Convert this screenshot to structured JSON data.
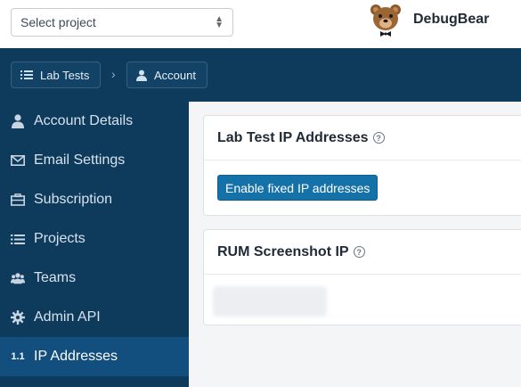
{
  "topbar": {
    "project_select": {
      "value": "Select project",
      "icon": "sort-caret-icon"
    },
    "brand": {
      "name": "DebugBear",
      "logo": "bear-logo"
    }
  },
  "breadcrumb": {
    "items": [
      {
        "label": "Lab Tests",
        "icon": "list-icon"
      },
      {
        "label": "Account",
        "icon": "user-icon"
      }
    ],
    "separator": "›"
  },
  "sidebar": {
    "items": [
      {
        "label": "Account Details",
        "icon": "user-icon"
      },
      {
        "label": "Email Settings",
        "icon": "envelope-icon"
      },
      {
        "label": "Subscription",
        "icon": "briefcase-icon"
      },
      {
        "label": "Projects",
        "icon": "list-icon"
      },
      {
        "label": "Teams",
        "icon": "users-icon"
      },
      {
        "label": "Admin API",
        "icon": "gear-icon"
      },
      {
        "label": "IP Addresses",
        "icon": "numbering-icon",
        "prefix": "1.1",
        "active": true
      }
    ]
  },
  "main": {
    "lab_card": {
      "title": "Lab Test IP Addresses",
      "button": "Enable fixed IP addresses"
    },
    "rum_card": {
      "title": "RUM Screenshot IP"
    },
    "help_glyph": "?"
  },
  "colors": {
    "nav_bg": "#0e3a5c",
    "active_bg": "#124f7e",
    "button_bg": "#1572a8"
  }
}
